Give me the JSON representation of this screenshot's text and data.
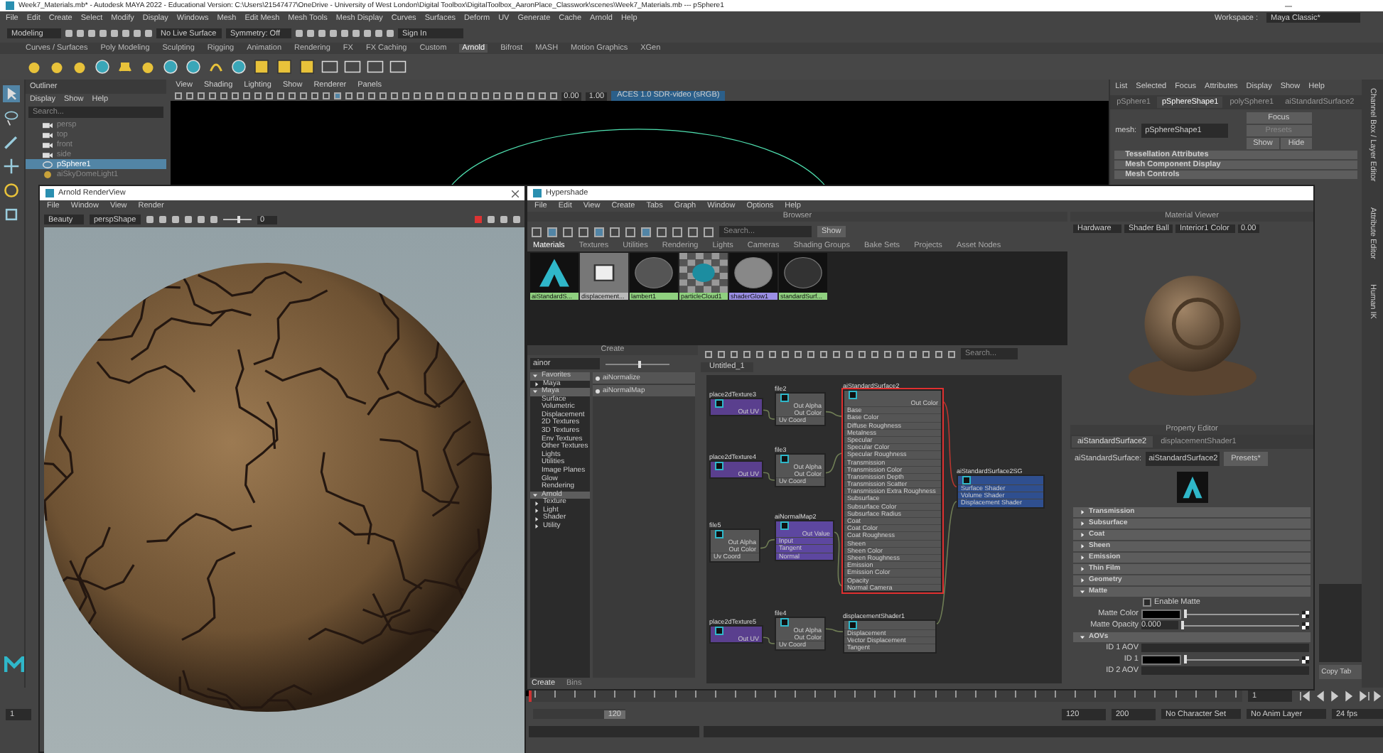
{
  "window": {
    "title": "Week7_Materials.mb* - Autodesk MAYA 2022 - Educational Version: C:\\Users\\21547477\\OneDrive - University of West London\\Digital Toolbox\\DigitalToolbox_AaronPlace_Classwork\\scenes\\Week7_Materials.mb  ---  pSphere1"
  },
  "menu_bar": [
    "File",
    "Edit",
    "Create",
    "Select",
    "Modify",
    "Display",
    "Windows",
    "Mesh",
    "Edit Mesh",
    "Mesh Tools",
    "Mesh Display",
    "Curves",
    "Surfaces",
    "Deform",
    "UV",
    "Generate",
    "Cache",
    "Arnold",
    "Help"
  ],
  "workspace": {
    "label": "Workspace :",
    "value": "Maya Classic*"
  },
  "status_line": {
    "menu_set": "Modeling",
    "live_surface": "No Live Surface",
    "symmetry": "Symmetry: Off",
    "sign_in": "Sign In"
  },
  "shelf_tabs": [
    {
      "label": "Curves / Surfaces",
      "selected": false
    },
    {
      "label": "Poly Modeling",
      "selected": false
    },
    {
      "label": "Sculpting",
      "selected": false
    },
    {
      "label": "Rigging",
      "selected": false
    },
    {
      "label": "Animation",
      "selected": false
    },
    {
      "label": "Rendering",
      "selected": false
    },
    {
      "label": "FX",
      "selected": false
    },
    {
      "label": "FX Caching",
      "selected": false
    },
    {
      "label": "Custom",
      "selected": false
    },
    {
      "label": "Arnold",
      "selected": true
    },
    {
      "label": "Bifrost",
      "selected": false
    },
    {
      "label": "MASH",
      "selected": false
    },
    {
      "label": "Motion Graphics",
      "selected": false
    },
    {
      "label": "XGen",
      "selected": false
    }
  ],
  "outliner": {
    "title": "Outliner",
    "menu": [
      "Display",
      "Show",
      "Help"
    ],
    "search_placeholder": "Search...",
    "items": [
      {
        "label": "persp",
        "kind": "camera",
        "selected": false
      },
      {
        "label": "top",
        "kind": "camera",
        "selected": false
      },
      {
        "label": "front",
        "kind": "camera",
        "selected": false
      },
      {
        "label": "side",
        "kind": "camera",
        "selected": false
      },
      {
        "label": "pSphere1",
        "kind": "mesh",
        "selected": true
      },
      {
        "label": "aiSkyDomeLight1",
        "kind": "light",
        "selected": false
      }
    ]
  },
  "viewport": {
    "menu": [
      "View",
      "Shading",
      "Lighting",
      "Show",
      "Renderer",
      "Panels"
    ],
    "exposure": "0.00",
    "gamma": "1.00",
    "color_space": "ACES 1.0 SDR-video (sRGB)"
  },
  "attribute_editor": {
    "menu": [
      "List",
      "Selected",
      "Focus",
      "Attributes",
      "Display",
      "Show",
      "Help"
    ],
    "tabs": [
      {
        "label": "pSphere1",
        "selected": false
      },
      {
        "label": "pSphereShape1",
        "selected": true
      },
      {
        "label": "polySphere1",
        "selected": false
      },
      {
        "label": "aiStandardSurface2",
        "selected": false
      }
    ],
    "field_label": "mesh:",
    "field_value": "pSphereShape1",
    "focus": "Focus",
    "presets": "Presets",
    "show": "Show",
    "hide": "Hide",
    "sections": [
      "Tessellation Attributes",
      "Mesh Component Display",
      "Mesh Controls"
    ],
    "copy_tab": "Copy Tab"
  },
  "side_tabs": [
    "Channel Box / Layer Editor",
    "Attribute Editor",
    "Human IK"
  ],
  "render_view": {
    "title": "Arnold RenderView",
    "menu": [
      "File",
      "Window",
      "View",
      "Render"
    ],
    "aov": "Beauty",
    "camera": "perspShape",
    "exposure": "0",
    "exposure_slider": {
      "level": 0.5
    }
  },
  "hypershade": {
    "title": "Hypershade",
    "menu": [
      "File",
      "Edit",
      "View",
      "Create",
      "Tabs",
      "Graph",
      "Window",
      "Options",
      "Help"
    ],
    "browser": {
      "title": "Browser",
      "search_placeholder": "Search...",
      "show": "Show",
      "tabs": [
        {
          "label": "Materials",
          "selected": true
        },
        {
          "label": "Textures",
          "selected": false
        },
        {
          "label": "Utilities",
          "selected": false
        },
        {
          "label": "Rendering",
          "selected": false
        },
        {
          "label": "Lights",
          "selected": false
        },
        {
          "label": "Cameras",
          "selected": false
        },
        {
          "label": "Shading Groups",
          "selected": false
        },
        {
          "label": "Bake Sets",
          "selected": false
        },
        {
          "label": "Projects",
          "selected": false
        },
        {
          "label": "Asset Nodes",
          "selected": false
        }
      ],
      "swatches": [
        {
          "label": "aiStandardS...",
          "kind": "arnold",
          "color": "#8fd07f"
        },
        {
          "label": "displacement...",
          "kind": "displacement",
          "color": "#b9b9b9"
        },
        {
          "label": "lambert1",
          "kind": "matte",
          "color": "#8fd07f"
        },
        {
          "label": "particleCloud1",
          "kind": "checker",
          "color": "#8fd07f"
        },
        {
          "label": "shaderGlow1",
          "kind": "glossy",
          "color": "#9b8fe6"
        },
        {
          "label": "standardSurf...",
          "kind": "dark",
          "color": "#8fd07f"
        }
      ]
    },
    "create": {
      "title": "Create",
      "filter": "ainor",
      "icon_size": {
        "level": 0.5
      },
      "categories": [
        {
          "label": "Favorites",
          "expanded": true,
          "children": [
            {
              "label": "Maya",
              "expanded": false
            }
          ]
        },
        {
          "label": "Maya",
          "expanded": true,
          "children": [
            {
              "label": "Surface"
            },
            {
              "label": "Volumetric"
            },
            {
              "label": "Displacement"
            },
            {
              "label": "2D Textures"
            },
            {
              "label": "3D Textures"
            },
            {
              "label": "Env Textures"
            },
            {
              "label": "Other Textures"
            },
            {
              "label": "Lights"
            },
            {
              "label": "Utilities"
            },
            {
              "label": "Image Planes"
            },
            {
              "label": "Glow"
            },
            {
              "label": "Rendering"
            }
          ]
        },
        {
          "label": "Arnold",
          "expanded": true,
          "children": [
            {
              "label": "Texture",
              "expanded": false
            },
            {
              "label": "Light",
              "expanded": false
            },
            {
              "label": "Shader",
              "expanded": false
            },
            {
              "label": "Utility",
              "expanded": false
            }
          ]
        }
      ],
      "results": [
        "aiNormalize",
        "aiNormalMap"
      ],
      "bottom_tabs": [
        {
          "label": "Create",
          "selected": true
        },
        {
          "label": "Bins",
          "selected": false
        }
      ]
    },
    "graph": {
      "tab": "Untitled_1",
      "search_placeholder": "Search...",
      "nodes": [
        {
          "title": "place2dTexture3",
          "kind": "place2d",
          "selected": false,
          "outputs": [
            "Out UV"
          ]
        },
        {
          "title": "file2",
          "kind": "file",
          "selected": false,
          "outputs": [
            "Out Alpha",
            "Out Color"
          ],
          "inputs": [
            "Uv Coord"
          ]
        },
        {
          "title": "aiStandardSurface2",
          "kind": "shader",
          "selected": true,
          "outputs": [
            "Out Color"
          ],
          "inputs": [
            "Base",
            "Base Color",
            "Diffuse Roughness",
            "Metalness",
            "Specular",
            "Specular Color",
            "Specular Roughness",
            "Transmission",
            "Transmission Color",
            "Transmission Depth",
            "Transmission Scatter",
            "Transmission Extra Roughness",
            "Subsurface",
            "Subsurface Color",
            "Subsurface Radius",
            "Coat",
            "Coat Color",
            "Coat Roughness",
            "Sheen",
            "Sheen Color",
            "Sheen Roughness",
            "Emission",
            "Emission Color",
            "Opacity",
            "Normal Camera"
          ]
        },
        {
          "title": "place2dTexture4",
          "kind": "place2d",
          "selected": false,
          "outputs": [
            "Out UV"
          ]
        },
        {
          "title": "file3",
          "kind": "file",
          "selected": false,
          "outputs": [
            "Out Alpha",
            "Out Color"
          ],
          "inputs": [
            "Uv Coord"
          ]
        },
        {
          "title": "aiStandardSurface2SG",
          "kind": "group",
          "selected": false,
          "inputs": [
            "Surface Shader",
            "Volume Shader",
            "Displacement Shader"
          ]
        },
        {
          "title": "file5",
          "kind": "file",
          "selected": false,
          "outputs": [
            "Out Alpha",
            "Out Color"
          ],
          "inputs": [
            "Uv Coord"
          ]
        },
        {
          "title": "aiNormalMap2",
          "kind": "normalmap",
          "selected": false,
          "outputs": [
            "Out Value"
          ],
          "inputs": [
            "Input",
            "Tangent",
            "Normal"
          ]
        },
        {
          "title": "place2dTexture5",
          "kind": "place2d",
          "selected": false,
          "outputs": [
            "Out UV"
          ]
        },
        {
          "title": "file4",
          "kind": "file",
          "selected": false,
          "outputs": [
            "Out Alpha",
            "Out Color"
          ],
          "inputs": [
            "Uv Coord"
          ]
        },
        {
          "title": "displacementShader1",
          "kind": "displacement",
          "selected": false,
          "inputs": [
            "Displacement",
            "Vector Displacement",
            "Tangent"
          ]
        }
      ]
    },
    "material_viewer": {
      "title": "Material Viewer",
      "renderer": "Hardware",
      "geometry": "Shader Ball",
      "environment": "Interior1 Color",
      "exposure": "0.00"
    },
    "property_editor": {
      "title": "Property Editor",
      "tabs": [
        {
          "label": "aiStandardSurface2",
          "selected": true
        },
        {
          "label": "displacementShader1",
          "selected": false
        }
      ],
      "node_label": "aiStandardSurface:",
      "node_value": "aiStandardSurface2",
      "presets": "Presets*",
      "sections": [
        {
          "label": "Transmission",
          "expanded": false
        },
        {
          "label": "Subsurface",
          "expanded": false
        },
        {
          "label": "Coat",
          "expanded": false
        },
        {
          "label": "Sheen",
          "expanded": false
        },
        {
          "label": "Emission",
          "expanded": false
        },
        {
          "label": "Thin Film",
          "expanded": false
        },
        {
          "label": "Geometry",
          "expanded": false
        },
        {
          "label": "Matte",
          "expanded": true,
          "rows": [
            {
              "kind": "checkbox",
              "label": "Enable Matte",
              "checked": false
            },
            {
              "kind": "color",
              "label": "Matte Color",
              "level": 0
            },
            {
              "kind": "number",
              "label": "Matte Opacity",
              "value": "0.000",
              "level": 0
            }
          ]
        },
        {
          "label": "AOVs",
          "expanded": true,
          "rows": [
            {
              "kind": "text",
              "label": "ID 1 AOV"
            },
            {
              "kind": "color",
              "label": "ID 1",
              "level": 0
            },
            {
              "kind": "text",
              "label": "ID 2 AOV"
            }
          ]
        }
      ]
    }
  },
  "time_slider": {
    "playhead": {
      "level": 0
    },
    "current": "1",
    "range_start": "1",
    "range": {
      "handle": "120",
      "level": 1
    },
    "end": "120",
    "anim_end": "200",
    "character_set": "No Character Set",
    "anim_layer": "No Anim Layer",
    "fps": "24 fps"
  }
}
